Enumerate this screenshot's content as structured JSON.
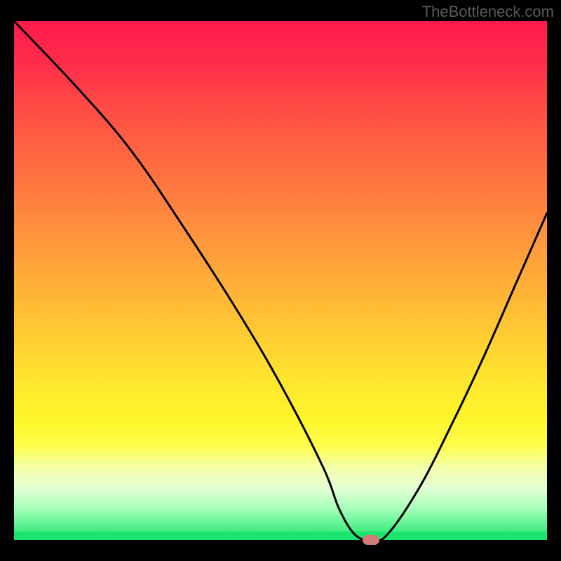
{
  "watermark": "TheBottleneck.com",
  "chart_data": {
    "type": "line",
    "title": "",
    "xlabel": "",
    "ylabel": "",
    "xlim": [
      0,
      100
    ],
    "ylim": [
      0,
      100
    ],
    "series": [
      {
        "name": "curve",
        "x": [
          0,
          12,
          22,
          32,
          42,
          50,
          58,
          61,
          64,
          67,
          70,
          76,
          82,
          88,
          94,
          100
        ],
        "values": [
          100,
          87,
          75,
          60,
          44,
          30,
          14,
          6,
          1,
          0,
          1,
          10,
          22,
          35,
          49,
          63
        ]
      }
    ],
    "marker": {
      "x": 67,
      "y": 0,
      "color": "#d17c78"
    },
    "gradient": {
      "top": "#ff1a4c",
      "bottom": "#1be56e"
    }
  }
}
